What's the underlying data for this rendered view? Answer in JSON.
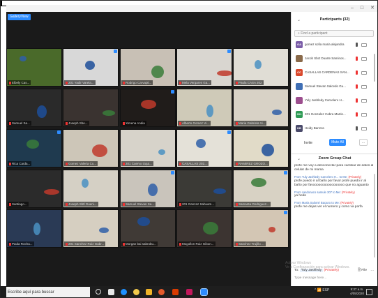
{
  "view_button": "GalleryView",
  "window_controls": [
    "–",
    "□",
    "✕"
  ],
  "tiles": [
    {
      "label": "Elbely Cas...",
      "bg": "#4a6a2a"
    },
    {
      "label": "201 Yadir Varela...",
      "bg": "#d8d8d8"
    },
    {
      "label": "Rodrigo Carvajal...",
      "bg": "#c8c0b5"
    },
    {
      "label": "Mela Vergares Ga...",
      "bg": "#d9d6d0"
    },
    {
      "label": "Paula CASA 202",
      "bg": "#e0ddd5"
    },
    {
      "label": "Samuel Sa...",
      "bg": "#2a2a2a"
    },
    {
      "label": "Joseph Sbe...",
      "bg": "#3a3330"
    },
    {
      "label": "Ximena Andia",
      "bg": "#201c1a"
    },
    {
      "label": "Alberto Gomez Vi...",
      "bg": "#cfcab8"
    },
    {
      "label": "Maria Gabriela Vi...",
      "bg": "#d8d2c6"
    },
    {
      "label": "Rica Carda...",
      "bg": "#1f3a4f"
    },
    {
      "label": "Gomez Valeria Cu...",
      "bg": "#cdc6b8"
    },
    {
      "label": "201 Cuervo Izqui...",
      "bg": "#d7d3ca"
    },
    {
      "label": "CASALLAS 202...",
      "bg": "#e4e1d8"
    },
    {
      "label": "RAMIREZ GROZO...",
      "bg": "#e1dbc8"
    },
    {
      "label": "Santiago...",
      "bg": "#2b2b2b"
    },
    {
      "label": "Joseph Sbtl Gueni...",
      "bg": "#d5d0c5"
    },
    {
      "label": "Samuel Stevan Sa...",
      "bg": "#c9c4bb"
    },
    {
      "label": "201 Ganzaz Sahuam...",
      "bg": "#3b3a36"
    },
    {
      "label": "Samanta Ondriguez...",
      "bg": "#d8d2c4"
    },
    {
      "label": "Paula Rocha...",
      "bg": "#2a3a55"
    },
    {
      "label": "201 Sanchez Ruiz Gabr...",
      "bg": "#d6cfc1"
    },
    {
      "label": "Morgan bai sabrobu...",
      "bg": "#403a36"
    },
    {
      "label": "Mogollon Ruiz Gibon...",
      "bg": "#3c3431"
    },
    {
      "label": "Sanchez Trujillo ...",
      "bg": "#d3c6b4"
    }
  ],
  "participants_panel": {
    "title": "Participants (32)",
    "search_placeholder": "Find a participant",
    "participants": [
      {
        "initials": "GA",
        "name": "gomez sofia maria alejandra",
        "color": "#7b5da8",
        "muted": false
      },
      {
        "initials": "",
        "name": "Jacob Sbct Duarte Saminos...",
        "color": "#8a6a4a",
        "muted": true
      },
      {
        "initials": "CC",
        "name": "CASALLAS CARDENAS SAN...",
        "color": "#d9472b",
        "muted": true
      },
      {
        "initials": "",
        "name": "Samuel Stevan Salcedo Gu...",
        "color": "#3f6fb5",
        "muted": true
      },
      {
        "initials": "",
        "name": "Yuly Jashledy Carcelero H...",
        "color": "#9c4e8e",
        "muted": true
      },
      {
        "initials": "201",
        "name": "201 Gonzalez Cabra Martin...",
        "color": "#2f9b55",
        "muted": true
      },
      {
        "initials": "HB",
        "name": "Heidy Barrera",
        "color": "#4a4a6a",
        "muted": false
      }
    ],
    "invite_label": "Invite",
    "mute_all_label": "Mute All",
    "more_label": "..."
  },
  "chat_panel": {
    "title": "Zoom Group Chat",
    "messages": [
      {
        "from": "",
        "to": "",
        "text": "profe me voy a desconectar para cambiar de datos al celular de mi mama"
      },
      {
        "from": "From Yuly Jashledy Carcelero H... to Me:",
        "to": "(Privately)",
        "text": "profe puedo ir al baño por favor profe puedo ir al baño por favooooooooooooooooo que no aguanto"
      },
      {
        "from": "From casdonaco samule 307 to Me:",
        "to": "(Privately)",
        "text": "ya hedo"
      },
      {
        "from": "From Maria Salomé Bacano to Me:",
        "to": "(Privately)",
        "text": "profe me dejas ver el numero y como va porfa"
      }
    ],
    "to_prefix": "To:",
    "to_recipient": "Yuly Jashledy",
    "to_privately": "(Privately)",
    "file_label": "File",
    "input_placeholder": "Type message here..."
  },
  "watermark": [
    "Activar Windows",
    "Ve a Configuración para activar Windows."
  ],
  "taskbar": {
    "search_text": "Escribe aquí para buscar",
    "tray_text": "^ 📶 ESP",
    "time": "9:37 a.m.",
    "date": "4/05/2020"
  }
}
